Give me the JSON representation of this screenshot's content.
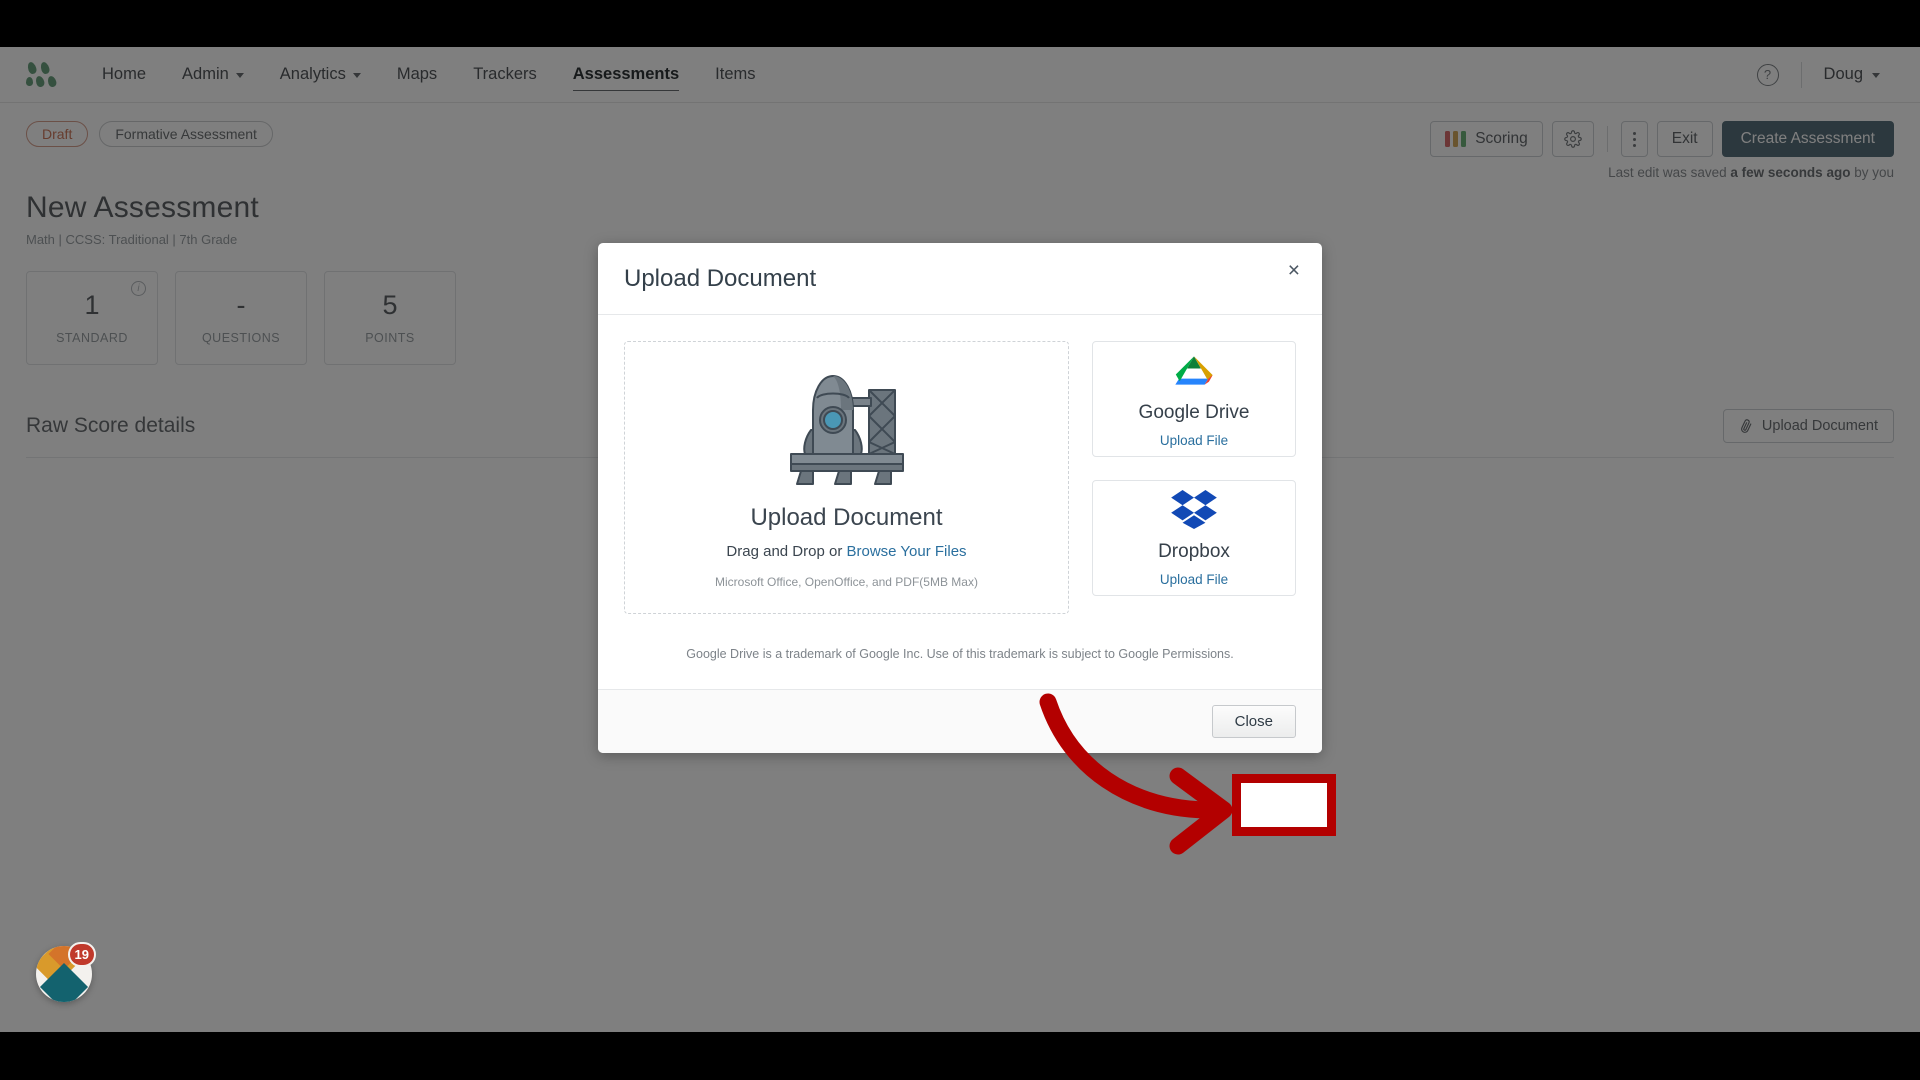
{
  "nav": {
    "logo_icon": "green-dots-logo",
    "items": [
      {
        "label": "Home",
        "dropdown": false,
        "active": false
      },
      {
        "label": "Admin",
        "dropdown": true,
        "active": false
      },
      {
        "label": "Analytics",
        "dropdown": true,
        "active": false
      },
      {
        "label": "Maps",
        "dropdown": false,
        "active": false
      },
      {
        "label": "Trackers",
        "dropdown": false,
        "active": false
      },
      {
        "label": "Assessments",
        "dropdown": false,
        "active": true
      },
      {
        "label": "Items",
        "dropdown": false,
        "active": false
      }
    ],
    "help_icon": "question-mark-icon",
    "user_name": "Doug"
  },
  "toolbar": {
    "pills": [
      {
        "label": "Draft",
        "style": "draft"
      },
      {
        "label": "Formative Assessment",
        "style": "plain"
      }
    ],
    "scoring_label": "Scoring",
    "scoring_colors": [
      "#d96d6d",
      "#d2a95c",
      "#6fb37a"
    ],
    "settings_icon": "gear-icon",
    "more_icon": "kebab-menu-icon",
    "exit_label": "Exit",
    "create_label": "Create Assessment",
    "create_color": "#59707c",
    "saved_prefix": "Last edit was saved",
    "saved_time": "a few seconds ago",
    "saved_suffix": "by you"
  },
  "page": {
    "title": "New Assessment",
    "meta": "Math  |  CCSS: Traditional  |  7th Grade",
    "stats": [
      {
        "value": "1",
        "label": "STANDARD",
        "info": true
      },
      {
        "value": "-",
        "label": "QUESTIONS",
        "info": false
      },
      {
        "value": "5",
        "label": "POINTS",
        "info": false
      }
    ],
    "section_title": "Raw Score details",
    "upload_button": "Upload Document",
    "upload_icon": "paperclip-icon"
  },
  "modal": {
    "title": "Upload Document",
    "close_icon": "close-x-icon",
    "dropzone": {
      "illustration": "rocket-launchpad-illustration",
      "title": "Upload Document",
      "drag_text": "Drag and Drop or",
      "browse_link": "Browse Your Files",
      "note": "Microsoft Office, OpenOffice, and PDF(5MB Max)"
    },
    "providers": [
      {
        "name": "Google Drive",
        "link": "Upload File",
        "icon": "google-drive-icon"
      },
      {
        "name": "Dropbox",
        "link": "Upload File",
        "icon": "dropbox-icon"
      }
    ],
    "trademark": "Google Drive is a trademark of Google Inc. Use of this trademark is subject to Google Permissions.",
    "close_button": "Close"
  },
  "annotation": {
    "color": "#b30000",
    "arrow_icon": "curved-arrow-icon",
    "highlight_target": "close-button"
  },
  "fab": {
    "badge_count": "19",
    "icon": "chat-widget-icon"
  }
}
